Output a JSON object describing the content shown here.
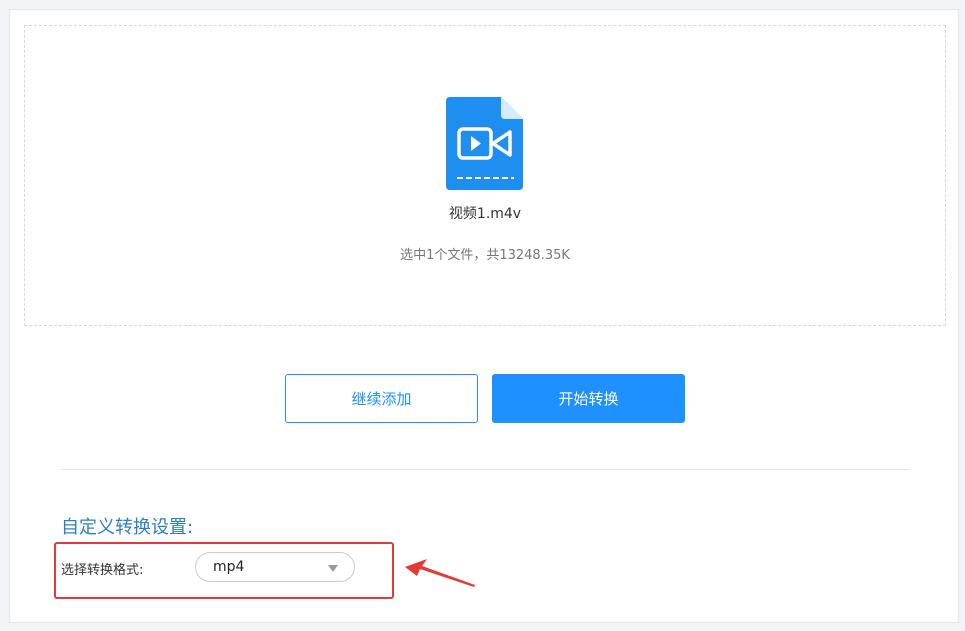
{
  "dropzone": {
    "file_name": "视频1.m4v",
    "summary": "选中1个文件，共13248.35K",
    "file_icon": "video-file-icon"
  },
  "actions": {
    "add_more_label": "继续添加",
    "start_convert_label": "开始转换"
  },
  "settings": {
    "title": "自定义转换设置:",
    "format_label": "选择转换格式:",
    "format_value": "mp4"
  },
  "colors": {
    "accent": "#1e90ff",
    "title": "#2b7fc8",
    "highlight": "#e53935"
  }
}
